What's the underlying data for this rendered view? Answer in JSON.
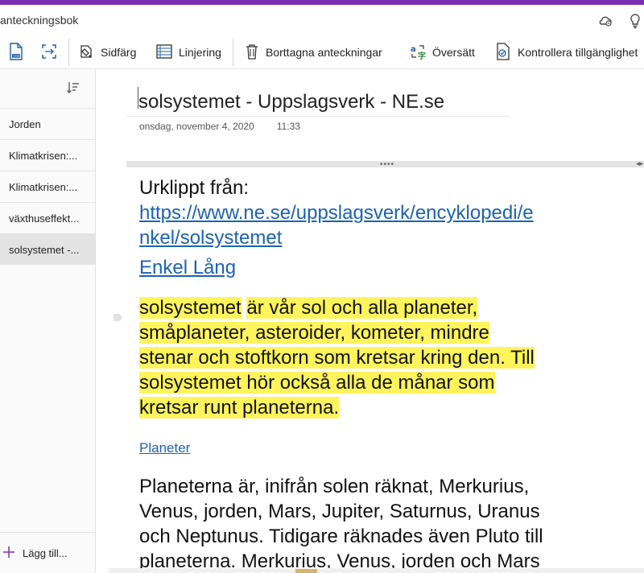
{
  "app": {
    "title": "anteckningsbok"
  },
  "ribbon": {
    "buttons": [
      {
        "label": "",
        "icon": "page-template-icon"
      },
      {
        "label": "",
        "icon": "page-size-icon"
      },
      {
        "label": "Sidfärg",
        "icon": "page-color-icon"
      },
      {
        "label": "Linjering",
        "icon": "rule-lines-icon"
      },
      {
        "label": "Borttagna anteckningar",
        "icon": "trash-icon"
      },
      {
        "label": "Översätt",
        "icon": "translate-icon"
      },
      {
        "label": "Kontrollera tillgänglighet",
        "icon": "accessibility-check-icon"
      }
    ]
  },
  "sidebar": {
    "pages": [
      "Jorden",
      "Klimatkrisen:...",
      "Klimatkrisen:...",
      "växthuseffekt...",
      "solsystemet -..."
    ],
    "active_index": 4,
    "add_label": "Lägg till..."
  },
  "page": {
    "title": "solsystemet - Uppslagsverk - NE.se",
    "date": "onsdag, november 4, 2020",
    "time": "11:33"
  },
  "note": {
    "clip_label": "Urklippt från:",
    "url_line1": "https://www.ne.se/uppslagsverk/encyklopedi/e",
    "url_line2": "nkel/solsystemet",
    "tab_link": "Enkel Lång",
    "hl_word": "solsystemet",
    "hl_line1_rest": " är vår sol och alla planeter,",
    "hl_line2": "småplaneter, asteroider, kometer, mindre",
    "hl_line3": "stenar och stoftkorn som kretsar kring den. Till",
    "hl_line4": "solsystemet hör också alla de månar som",
    "hl_line5": "kretsar runt planeterna.",
    "section_link": "Planeter",
    "p_line1": "Planeterna är, inifrån solen räknat, Merkurius,",
    "p_line2": "Venus, jorden, Mars, Jupiter, Saturnus, Uranus",
    "p_line3": "och Neptunus. Tidigare räknades även Pluto till",
    "p_line4": "planeterna. Merkurius, Venus, jorden och Mars"
  }
}
